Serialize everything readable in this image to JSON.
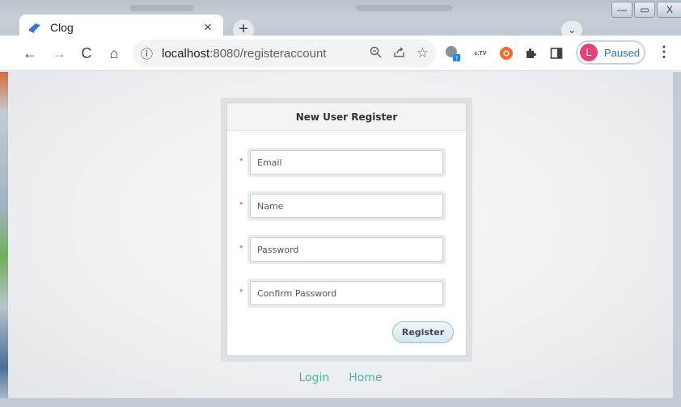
{
  "browser": {
    "tab_title": "Clog",
    "tab_close": "×",
    "new_tab": "+",
    "tab_search": "⌄",
    "window_controls": {
      "minimize": "—",
      "maximize": "▭",
      "close": "X"
    },
    "nav": {
      "back": "←",
      "forward": "→",
      "reload": "C",
      "home": "⌂"
    },
    "url_host": "localhost",
    "url_rest": ":8080/registeraccount",
    "omnibox_icons": {
      "zoom": "🔍",
      "share": "⇪",
      "bookmark": "☆"
    },
    "extensions": [
      "extension-avatar-icon",
      "ctv-extension-icon",
      "orange-extension-icon",
      "puzzle-icon",
      "side-panel-icon"
    ],
    "ext_ctv_label": "c.TV",
    "profile": {
      "initial": "L",
      "label": "Paused"
    },
    "menu": "⋮",
    "accent": "#1a73e8"
  },
  "form": {
    "title": "New User Register",
    "required_mark": "*",
    "fields": [
      {
        "placeholder": "Email"
      },
      {
        "placeholder": "Name"
      },
      {
        "placeholder": "Password"
      },
      {
        "placeholder": "Confirm Password"
      }
    ],
    "submit_label": "Register"
  },
  "links": {
    "login": "Login",
    "home": "Home",
    "color": "#4fb3a7"
  }
}
